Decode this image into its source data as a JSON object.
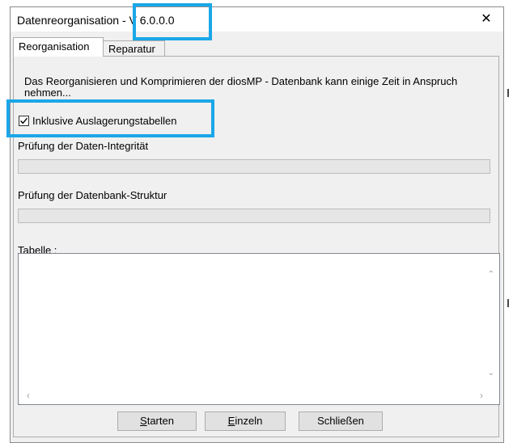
{
  "window": {
    "title_prefix": "Datenreorganisation - ",
    "title_version": "V 6.0.0.0",
    "close_glyph": "✕"
  },
  "tabs": [
    {
      "label": "Reorganisation",
      "active": true
    },
    {
      "label": "Reparatur",
      "active": false
    }
  ],
  "description": "Das Reorganisieren und Komprimieren der diosMP - Datenbank kann einige Zeit in Anspruch nehmen...",
  "checkbox": {
    "label": "Inklusive Auslagerungstabellen",
    "checked": true
  },
  "progress": [
    {
      "label": "Prüfung der Daten-Integrität",
      "value": 0
    },
    {
      "label": "Prüfung der Datenbank-Struktur",
      "value": 0
    }
  ],
  "table": {
    "label": "Tabelle :",
    "items": []
  },
  "buttons": {
    "start": "Starten",
    "single": "Einzeln",
    "close": "Schließen"
  },
  "scroll_glyphs": {
    "up": "⌃",
    "down": "⌄",
    "left": "‹",
    "right": "›"
  },
  "colors": {
    "highlight": "#1aa7e8",
    "progress_fill": "#06b025"
  }
}
